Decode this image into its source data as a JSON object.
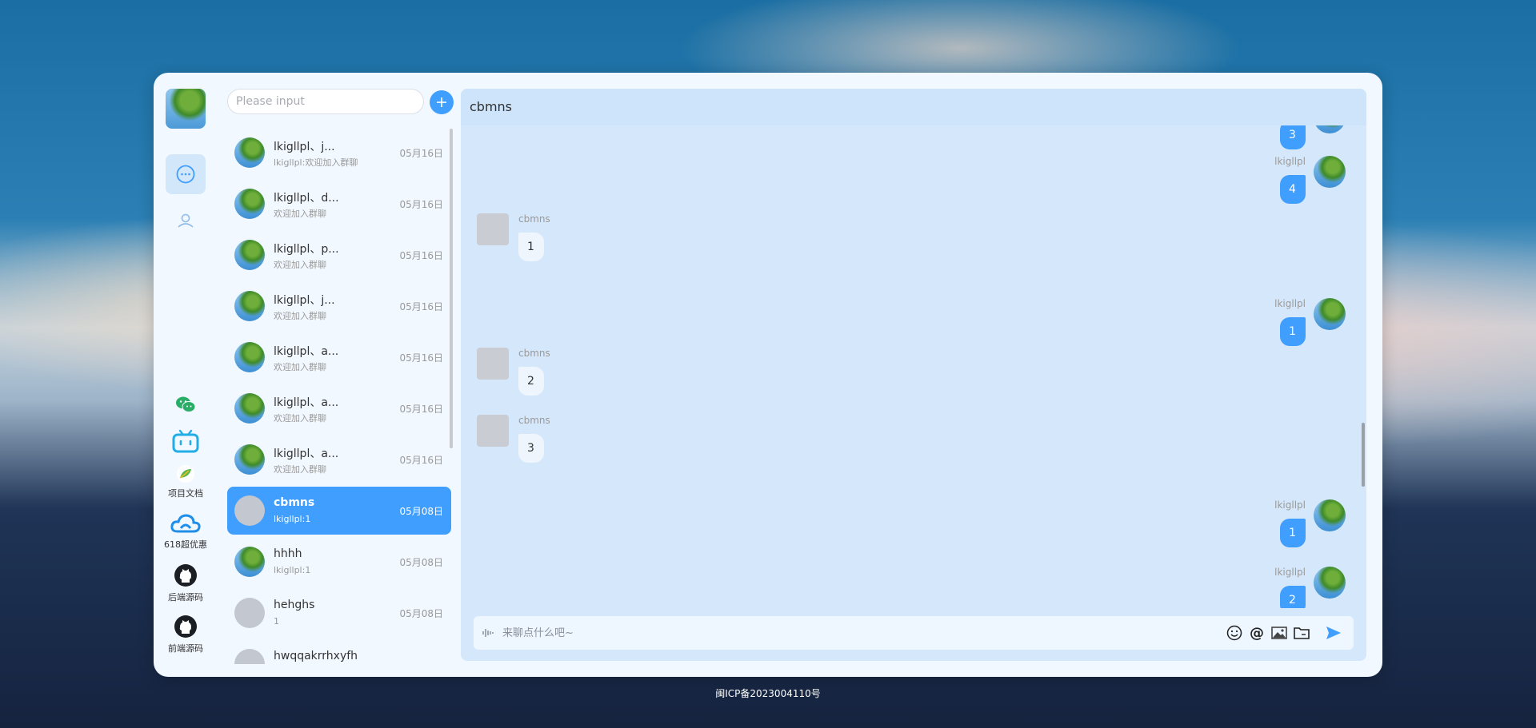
{
  "colors": {
    "accent": "#409eff",
    "panel": "#d5e8fb"
  },
  "nav": {
    "items": [
      {
        "icon": "chat-bubble-icon",
        "active": true
      },
      {
        "icon": "contacts-icon",
        "active": false
      }
    ],
    "external": [
      {
        "icon": "wechat-icon",
        "label": ""
      },
      {
        "icon": "bilibili-icon",
        "label": ""
      },
      {
        "icon": "docs-leaf-icon",
        "label": "项目文档"
      },
      {
        "icon": "cloud-icon",
        "label": "618超优惠"
      },
      {
        "icon": "github-icon",
        "label": "后端源码"
      },
      {
        "icon": "github-icon",
        "label": "前端源码"
      }
    ]
  },
  "search": {
    "placeholder": "Please input",
    "value": ""
  },
  "conversations": [
    {
      "name": "lkigllpl、j...",
      "preview": "lkigllpl:欢迎加入群聊",
      "time": "05月16日",
      "avatar": "photo",
      "active": false
    },
    {
      "name": "lkigllpl、d...",
      "preview": "欢迎加入群聊",
      "time": "05月16日",
      "avatar": "photo",
      "active": false
    },
    {
      "name": "lkigllpl、p...",
      "preview": "欢迎加入群聊",
      "time": "05月16日",
      "avatar": "photo",
      "active": false
    },
    {
      "name": "lkigllpl、j...",
      "preview": "欢迎加入群聊",
      "time": "05月16日",
      "avatar": "photo",
      "active": false
    },
    {
      "name": "lkigllpl、a...",
      "preview": "欢迎加入群聊",
      "time": "05月16日",
      "avatar": "photo",
      "active": false
    },
    {
      "name": "lkigllpl、a...",
      "preview": "欢迎加入群聊",
      "time": "05月16日",
      "avatar": "photo",
      "active": false
    },
    {
      "name": "lkigllpl、a...",
      "preview": "欢迎加入群聊",
      "time": "05月16日",
      "avatar": "photo",
      "active": false
    },
    {
      "name": "cbmns",
      "preview": "lkigllpl:1",
      "time": "05月08日",
      "avatar": "grey",
      "active": true
    },
    {
      "name": "hhhh",
      "preview": "lkigllpl:1",
      "time": "05月08日",
      "avatar": "photo",
      "active": false
    },
    {
      "name": "hehghs",
      "preview": "1",
      "time": "05月08日",
      "avatar": "grey",
      "active": false
    },
    {
      "name": "hwqqakrrhxyfh",
      "preview": "",
      "time": "",
      "avatar": "grey",
      "active": false
    }
  ],
  "chat": {
    "title": "cbmns",
    "messages": [
      {
        "side": "right",
        "sender": "",
        "text": "3"
      },
      {
        "side": "right",
        "sender": "lkigllpl",
        "text": "4"
      },
      {
        "side": "left",
        "sender": "cbmns",
        "text": "1"
      },
      {
        "side": "right",
        "sender": "lkigllpl",
        "text": "1"
      },
      {
        "side": "left",
        "sender": "cbmns",
        "text": "2"
      },
      {
        "side": "left",
        "sender": "cbmns",
        "text": "3"
      },
      {
        "side": "right",
        "sender": "lkigllpl",
        "text": "1"
      },
      {
        "side": "right",
        "sender": "lkigllpl",
        "text": "2"
      }
    ],
    "composer": {
      "placeholder": "来聊点什么吧~",
      "value": "",
      "tools": [
        "emoji-icon",
        "at-icon",
        "image-icon",
        "folder-icon"
      ],
      "send_icon": "send-icon"
    }
  },
  "footer": {
    "icp": "闽ICP备2023004110号"
  }
}
